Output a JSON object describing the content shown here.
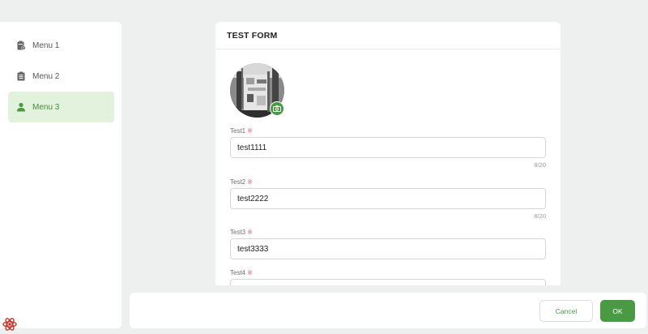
{
  "sidebar": {
    "items": [
      {
        "label": "Menu 1",
        "icon": "clipboard-clock-icon"
      },
      {
        "label": "Menu 2",
        "icon": "clipboard-list-icon"
      },
      {
        "label": "Menu 3",
        "icon": "person-icon",
        "active": true
      }
    ]
  },
  "form": {
    "title": "TEST FORM",
    "required_mark": "※",
    "fields": [
      {
        "label": "Test1",
        "value": "test1111",
        "counter": "8/20"
      },
      {
        "label": "Test2",
        "value": "test2222",
        "counter": "8/20"
      },
      {
        "label": "Test3",
        "value": "test3333"
      },
      {
        "label": "Test4",
        "value": ""
      }
    ]
  },
  "footer": {
    "cancel_label": "Cancel",
    "ok_label": "OK"
  },
  "colors": {
    "accent": "#4a9a43",
    "active_bg": "#e3f2dc",
    "required": "#e06868",
    "background": "#eef0ef"
  }
}
